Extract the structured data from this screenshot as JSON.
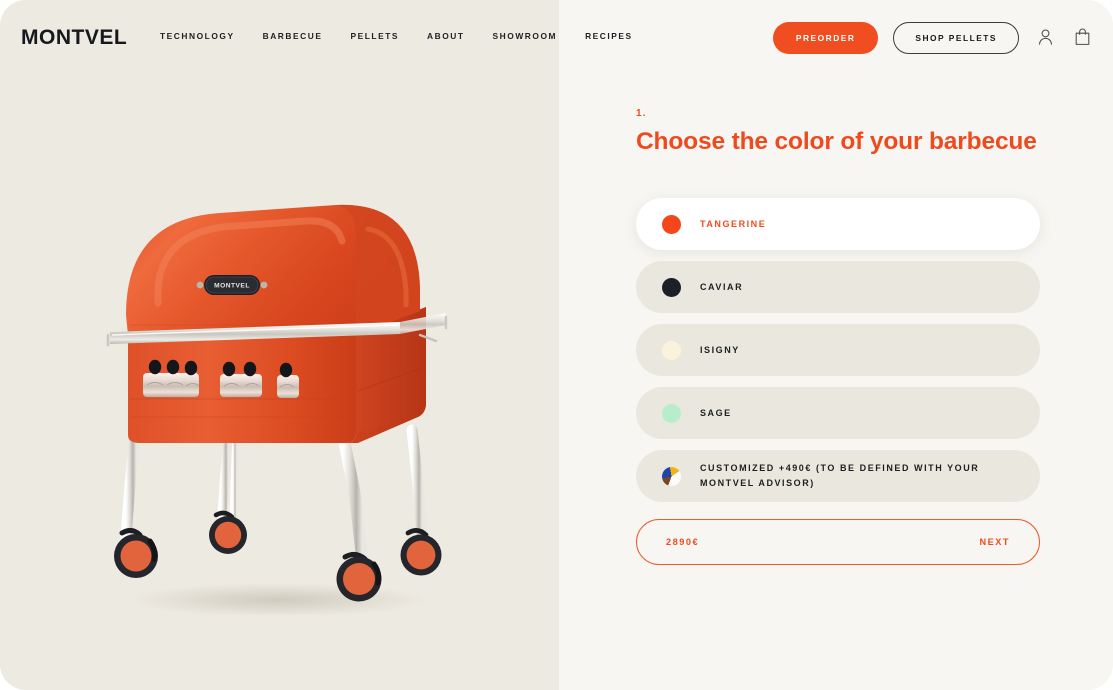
{
  "brand": {
    "logo": "MONTVEL"
  },
  "nav": {
    "items": [
      {
        "label": "TECHNOLOGY"
      },
      {
        "label": "BARBECUE"
      },
      {
        "label": "PELLETS"
      },
      {
        "label": "ABOUT"
      },
      {
        "label": "SHOWROOM"
      },
      {
        "label": "RECIPES"
      }
    ]
  },
  "header_actions": {
    "preorder_label": "PREORDER",
    "shop_pellets_label": "SHOP PELLETS",
    "account_icon": "user-icon",
    "cart_icon": "shopping-bag-icon"
  },
  "product": {
    "badge_text": "MONTVEL",
    "body_color": "#e4572b",
    "alt": "Orange MONTVEL barbecue grill on chrome legs with casters"
  },
  "configurator": {
    "step_number": "1.",
    "title": "Choose the color of your barbecue",
    "options": [
      {
        "label": "TANGERINE",
        "swatch": "#f4461a",
        "selected": true
      },
      {
        "label": "CAVIAR",
        "swatch": "#1c1f26",
        "selected": false
      },
      {
        "label": "ISIGNY",
        "swatch": "#faf3dc",
        "selected": false
      },
      {
        "label": "SAGE",
        "swatch": "#b8edcb",
        "selected": false
      },
      {
        "label": "CUSTOMIZED +490€ (TO BE DEFINED WITH YOUR MONTVEL ADVISOR)",
        "swatch": "multi",
        "selected": false
      }
    ],
    "price": "2890€",
    "next_label": "NEXT"
  },
  "colors": {
    "accent": "#f04d20",
    "ink": "#16181c",
    "panel_left": "#edeae2",
    "panel_right": "#f7f6f2"
  }
}
